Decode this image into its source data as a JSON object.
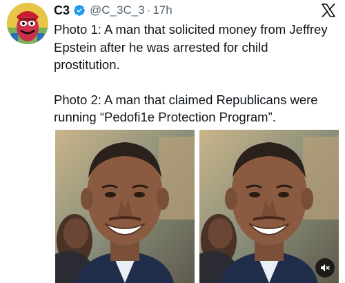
{
  "post": {
    "author": {
      "display_name": "C3",
      "handle": "@C_3C_3",
      "separator": "·",
      "timestamp": "17h"
    },
    "text": {
      "paragraph_1": "Photo 1: A man that solicited money from Jeffrey Epstein after he was arrested for child prostitution.",
      "paragraph_2": "Photo 2: A man that claimed Republicans were running “Pedofi1e Protection Program”."
    },
    "media": {
      "photos": [
        "photo-1",
        "photo-2"
      ],
      "audio_icon": "muted-speaker-icon"
    }
  },
  "colors": {
    "text": "#0f1419",
    "secondary": "#536471",
    "verified": "#1d9bf0"
  },
  "icons": {
    "verified": "verified-badge-icon",
    "brand": "x-logo-icon"
  }
}
